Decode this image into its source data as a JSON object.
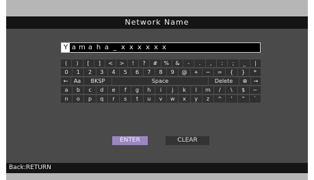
{
  "title": "Network Name",
  "name_field": {
    "chars": [
      "Y",
      "a",
      "m",
      "a",
      "h",
      "a",
      "_",
      "x",
      "x",
      "x",
      "x",
      "x",
      "x"
    ]
  },
  "keyboard": {
    "rows": [
      [
        "(",
        ")",
        "[",
        "]",
        "<",
        ">",
        "!",
        "?",
        "#",
        "%",
        "&",
        "-",
        ".",
        ",",
        ":",
        ";",
        "_",
        "|"
      ],
      [
        "0",
        "1",
        "2",
        "3",
        "4",
        "5",
        "6",
        "7",
        "8",
        "9",
        "@",
        "+",
        "−",
        "=",
        "{",
        "}",
        "*"
      ],
      [
        "a",
        "b",
        "c",
        "d",
        "e",
        "f",
        "g",
        "h",
        "i",
        "j",
        "k",
        "l",
        "m",
        "/",
        "\\",
        "$",
        "~"
      ],
      [
        "n",
        "o",
        "p",
        "q",
        "r",
        "s",
        "t",
        "u",
        "v",
        "w",
        "x",
        "y",
        "z",
        "^",
        "'",
        "\"",
        "`"
      ]
    ],
    "fn_row": {
      "left_arrow": "←",
      "aa": "Aa",
      "bksp": "BKSP",
      "space": "Space",
      "delete": "Delete",
      "globe": "⊕",
      "right_arrow": "→"
    }
  },
  "buttons": {
    "enter": "ENTER",
    "clear": "CLEAR"
  },
  "footer": "Back:RETURN",
  "colors": {
    "enter_button": "#9b86c2",
    "title_bar": "#151515",
    "panel": "#4a4a4a",
    "key": "#303030"
  }
}
